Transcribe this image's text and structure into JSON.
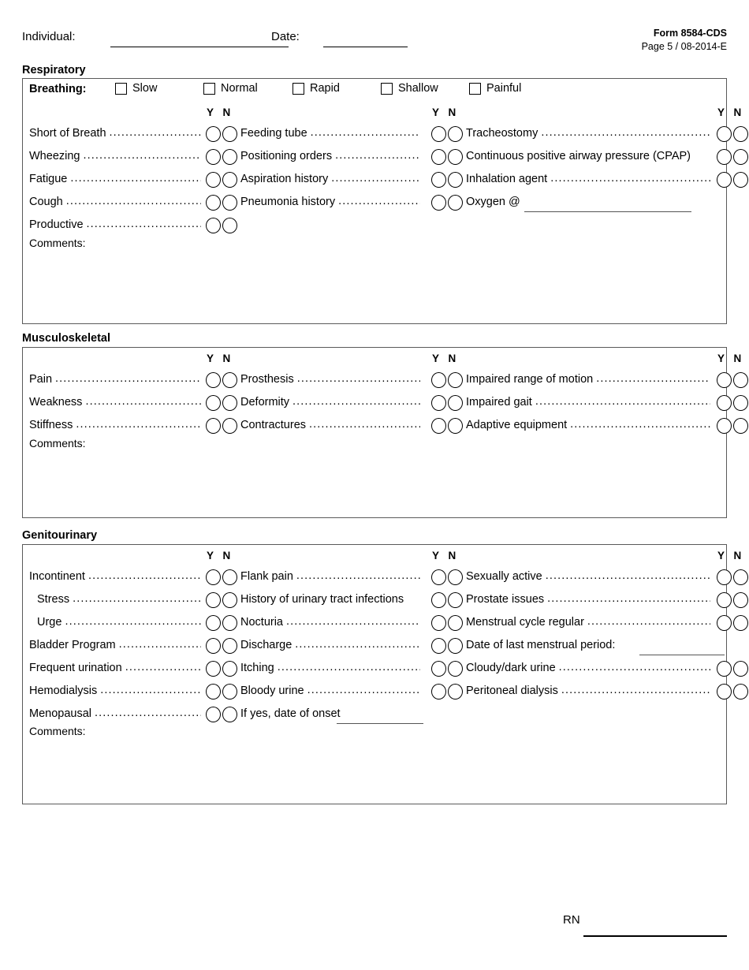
{
  "header": {
    "individual_label": "Individual:",
    "date_label": "Date:",
    "form_number": "Form 8584-CDS",
    "page_info": "Page 5 / 08-2014-E"
  },
  "yn_header": "Y N",
  "comments_label": "Comments:",
  "dot_leader": "........................................................................................................",
  "footer": {
    "rn_label": "RN"
  },
  "respiratory": {
    "title": "Respiratory",
    "breathing_label": "Breathing:",
    "breathing_options": [
      "Slow",
      "Normal",
      "Rapid",
      "Shallow",
      "Painful"
    ],
    "rows": [
      {
        "c1": "Short of Breath",
        "c2": "Feeding tube",
        "c3": "Tracheostomy"
      },
      {
        "c1": "Wheezing",
        "c2": "Positioning orders",
        "c3": "Continuous positive airway pressure (CPAP)"
      },
      {
        "c1": "Fatigue",
        "c2": "Aspiration history",
        "c3": "Inhalation agent"
      },
      {
        "c1": "Cough",
        "c2": "Pneumonia history",
        "c3": "Oxygen @"
      },
      {
        "c1": "Productive",
        "c2": "",
        "c3": ""
      }
    ]
  },
  "musculoskeletal": {
    "title": "Musculoskeletal",
    "rows": [
      {
        "c1": "Pain",
        "c2": "Prosthesis",
        "c3": "Impaired range of motion"
      },
      {
        "c1": "Weakness",
        "c2": "Deformity",
        "c3": "Impaired gait"
      },
      {
        "c1": "Stiffness",
        "c2": "Contractures",
        "c3": "Adaptive equipment"
      }
    ]
  },
  "genitourinary": {
    "title": "Genitourinary",
    "rows": [
      {
        "c1": "Incontinent",
        "c2": "Flank pain",
        "c3": "Sexually active"
      },
      {
        "c1": "Stress",
        "c2": "History of urinary tract infections",
        "c3": "Prostate issues"
      },
      {
        "c1": "Urge",
        "c2": "Nocturia",
        "c3": "Menstrual cycle regular"
      },
      {
        "c1": "Bladder Program",
        "c2": "Discharge",
        "c3": "Date of last menstrual period:"
      },
      {
        "c1": "Frequent urination",
        "c2": "Itching",
        "c3": "Cloudy/dark urine"
      },
      {
        "c1": "Hemodialysis",
        "c2": "Bloody urine",
        "c3": "Peritoneal dialysis"
      },
      {
        "c1": "Menopausal",
        "c2": "If yes, date of onset",
        "c3": ""
      }
    ]
  }
}
